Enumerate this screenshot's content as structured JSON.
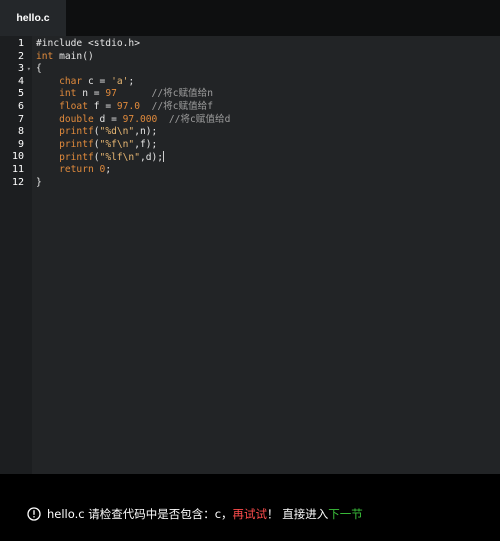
{
  "tab": {
    "label": "hello.c"
  },
  "editor": {
    "line_numbers": [
      "1",
      "2",
      "3",
      "4",
      "5",
      "6",
      "7",
      "8",
      "9",
      "10",
      "11",
      "12"
    ],
    "lines": [
      [
        {
          "t": "#include <stdio.h>",
          "c": "hd"
        }
      ],
      [
        {
          "t": "int",
          "c": "kw"
        },
        {
          "t": " main()",
          "c": ""
        }
      ],
      [
        {
          "t": "{",
          "c": ""
        }
      ],
      [
        {
          "t": "    ",
          "c": ""
        },
        {
          "t": "char",
          "c": "kw"
        },
        {
          "t": " c = ",
          "c": ""
        },
        {
          "t": "'a'",
          "c": "str"
        },
        {
          "t": ";",
          "c": ""
        }
      ],
      [
        {
          "t": "    ",
          "c": ""
        },
        {
          "t": "int",
          "c": "kw"
        },
        {
          "t": " n = ",
          "c": ""
        },
        {
          "t": "97",
          "c": "num"
        },
        {
          "t": "      ",
          "c": ""
        },
        {
          "t": "//将c赋值给n",
          "c": "cm"
        }
      ],
      [
        {
          "t": "    ",
          "c": ""
        },
        {
          "t": "float",
          "c": "kw"
        },
        {
          "t": " f = ",
          "c": ""
        },
        {
          "t": "97.0",
          "c": "num"
        },
        {
          "t": "  ",
          "c": ""
        },
        {
          "t": "//将c赋值给f",
          "c": "cm"
        }
      ],
      [
        {
          "t": "    ",
          "c": ""
        },
        {
          "t": "double",
          "c": "kw"
        },
        {
          "t": " d = ",
          "c": ""
        },
        {
          "t": "97.000",
          "c": "num"
        },
        {
          "t": "  ",
          "c": ""
        },
        {
          "t": "//将c赋值给d",
          "c": "cm"
        }
      ],
      [
        {
          "t": "    ",
          "c": ""
        },
        {
          "t": "printf",
          "c": "fn"
        },
        {
          "t": "(",
          "c": ""
        },
        {
          "t": "\"%d\\n\"",
          "c": "str"
        },
        {
          "t": ",n);",
          "c": ""
        }
      ],
      [
        {
          "t": "    ",
          "c": ""
        },
        {
          "t": "printf",
          "c": "fn"
        },
        {
          "t": "(",
          "c": ""
        },
        {
          "t": "\"%f\\n\"",
          "c": "str"
        },
        {
          "t": ",f);",
          "c": ""
        }
      ],
      [
        {
          "t": "    ",
          "c": ""
        },
        {
          "t": "printf",
          "c": "fn"
        },
        {
          "t": "(",
          "c": ""
        },
        {
          "t": "\"%lf\\n\"",
          "c": "str"
        },
        {
          "t": ",d);",
          "c": ""
        }
      ],
      [
        {
          "t": "    ",
          "c": ""
        },
        {
          "t": "return",
          "c": "kw"
        },
        {
          "t": " ",
          "c": ""
        },
        {
          "t": "0",
          "c": "num"
        },
        {
          "t": ";",
          "c": ""
        }
      ],
      [
        {
          "t": "}",
          "c": ""
        }
      ]
    ],
    "fold_marker_line": 3,
    "fold_icon": "fold-arrow-icon",
    "cursor_line": 10
  },
  "status": {
    "icon": "alert-circle-icon",
    "prefix": "hello.c 请检查代码中是否包含：c，",
    "retry": "再试试",
    "middle": "！ 直接进入",
    "next": "下一节"
  },
  "colors": {
    "keyword": "#e08a3c",
    "string": "#e6b673",
    "comment": "#9e9e9e",
    "retry": "#ff4d4d",
    "next": "#3cc33c"
  }
}
